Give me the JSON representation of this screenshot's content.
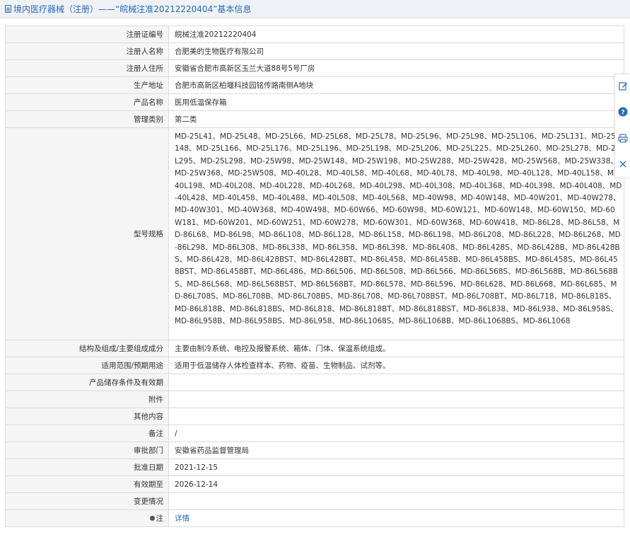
{
  "header": {
    "title": "境内医疗器械（注册）——“皖械注准20212220404”基本信息"
  },
  "fields": {
    "reg_no": {
      "label": "注册证编号",
      "value": "皖械注准20212220404"
    },
    "registrant": {
      "label": "注册人名称",
      "value": "合肥美的生物医疗有限公司"
    },
    "address": {
      "label": "注册人住所",
      "value": "安徽省合肥市高新区玉兰大道88号5号厂房"
    },
    "production": {
      "label": "生产地址",
      "value": "合肥市高新区柏堰科技园铭传路南侧A地块"
    },
    "product_name": {
      "label": "产品名称",
      "value": "医用低温保存箱"
    },
    "mgmt_class": {
      "label": "管理类别",
      "value": "第二类"
    },
    "model": {
      "label": "型号规格",
      "value": "MD-25L41、MD-25L48、MD-25L66、MD-25L68、MD-25L78、MD-25L96、MD-25L98、MD-25L106、MD-25L131、MD-25L148、MD-25L166、MD-25L176、MD-25L196、MD-25L198、MD-25L206、MD-25L225、MD-25L260、MD-25L278、MD-25L295、MD-25L298、MD-25W98、MD-25W148、MD-25W198、MD-25W288、MD-25W428、MD-25W568、MD-25W338、MD-25W368、MD-25W508、MD-40L28、MD-40L58、MD-40L68、MD-40L78、MD-40L98、MD-40L128、MD-40L158、MD-40L198、MD-40L208、MD-40L228、MD-40L268、MD-40L298、MD-40L308、MD-40L368、MD-40L398、MD-40L408、MD-40L428、MD-40L458、MD-40L488、MD-40L508、MD-40L568、MD-40W98、MD-40W148、MD-40W201、MD-40W278、MD-40W301、MD-40W368、MD-40W498、MD-60W66、MD-60W98、MD-60W121、MD-60W148、MD-60W150、MD-60W181、MD-60W201、MD-60W251、MD-60W278、MD-60W301、MD-60W368、MD-60W418、MD-86L28、MD-86L58、MD-86L68、MD-86L98、MD-86L108、MD-86L128、MD-86L158、MD-86L198、MD-86L208、MD-86L228、MD-86L268、MD-86L298、MD-86L308、MD-86L338、MD-86L358、MD-86L398、MD-86L408、MD-86L428S、MD-86L428B、MD-86L428BS、MD-86L428、MD-86L428BST、MD-86L428BT、MD-86L458、MD-86L458B、MD-86L458BS、MD-86L458S、MD-86L458BST、MD-86L458BT、MD-86L486、MD-86L506、MD-86L508、MD-86L566、MD-86L568S、MD-86L568B、MD-86L568BS、MD-86L568、MD-86L568BST、MD-86L568BT、MD-86L578、MD-86L596、MD-86L628、MD-86L668、MD-86L685、MD-86L708S、MD-86L708B、MD-86L708BS、MD-86L708、MD-86L708BST、MD-86L708BT、MD-86L718、MD-86L818S、MD-86L818B、MD-86L818BS、MD-86L818、MD-86L818BT、MD-86L818BST、MD-86L838、MD-86L938、MD-86L958S、MD-86L958B、MD-86L958BS、MD-86L958、MD-86L1068S、MD-86L1068B、MD-86L1068BS、MD-86L1068"
    },
    "structure": {
      "label": "结构及组成/主要组成成分",
      "value": "主要由制冷系统、电控及报警系统、箱体、门体、保温系统组成。"
    },
    "scope": {
      "label": "适用范围/预期用途",
      "value": "适用于低温储存人体检查样本、药物、疫苗、生物制品、试剂等。"
    },
    "storage": {
      "label": "产品储存条件及有效期",
      "value": ""
    },
    "attachment": {
      "label": "附件",
      "value": ""
    },
    "other": {
      "label": "其他内容",
      "value": ""
    },
    "remark": {
      "label": "备注",
      "value": "/"
    },
    "approval_dept": {
      "label": "审批部门",
      "value": "安徽省药品监督管理局"
    },
    "approval_date": {
      "label": "批准日期",
      "value": "2021-12-15"
    },
    "valid_until": {
      "label": "有效期至",
      "value": "2026-12-14"
    },
    "change": {
      "label": "变更情况",
      "value": ""
    },
    "note": {
      "label": "注",
      "value": "详情"
    }
  },
  "side_tools": {
    "icons": [
      "edit-icon",
      "help-icon",
      "print-icon",
      "close-icon"
    ],
    "accent_color": "#2b6ab6"
  }
}
